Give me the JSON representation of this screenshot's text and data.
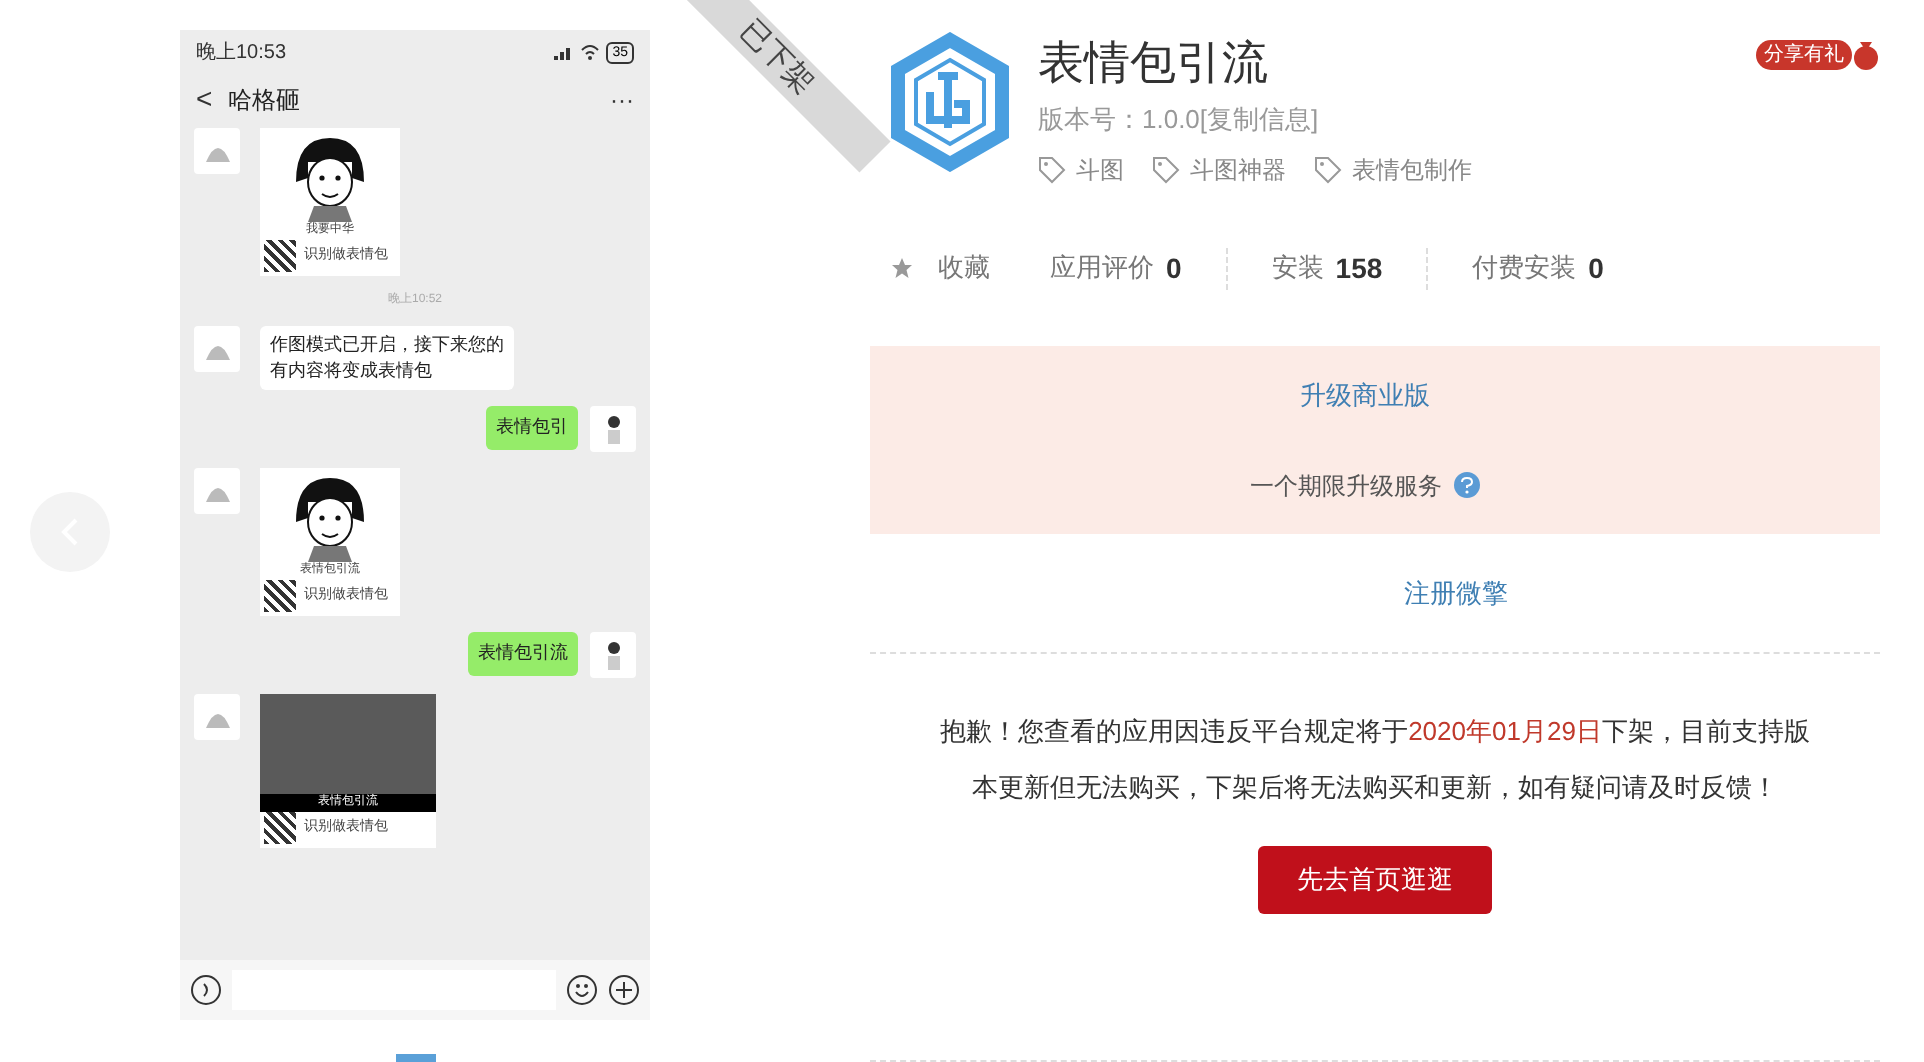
{
  "phone": {
    "status_time": "晚上10:53",
    "battery": "35",
    "back": "<",
    "chat_title": "哈格砸",
    "more": "···",
    "messages": [
      {
        "kind": "sticker",
        "caption": "我要中华",
        "qr_label": "识别做表情包"
      },
      {
        "kind": "time",
        "text": "晚上10:52"
      },
      {
        "kind": "text",
        "lines": [
          "作图模式已开启，接下来您的",
          "有内容将变成表情包"
        ]
      },
      {
        "kind": "outgoing",
        "text": "表情包引"
      },
      {
        "kind": "sticker",
        "caption": "表情包引流",
        "qr_label": "识别做表情包"
      },
      {
        "kind": "outgoing",
        "text": "表情包引流"
      },
      {
        "kind": "photo",
        "caption": "表情包引流",
        "qr_label": "识别做表情包"
      }
    ]
  },
  "ribbon": "已下架",
  "app": {
    "title": "表情包引流",
    "version": "版本号：1.0.0",
    "copy_link": "[复制信息]",
    "share_badge": "分享有礼",
    "tags": [
      "斗图",
      "斗图神器",
      "表情包制作"
    ]
  },
  "stats": [
    {
      "label": "收藏",
      "kind": "favorite"
    },
    {
      "label": "应用评价",
      "value": "0",
      "kind": "count"
    },
    {
      "label": "安装",
      "value": "158",
      "kind": "count"
    },
    {
      "label": "付费安装",
      "value": "0",
      "kind": "count"
    }
  ],
  "notice": {
    "upgrade_link": "升级商业版",
    "service_text": "一个期限升级服务",
    "register_link": "注册微擎"
  },
  "removal": {
    "before": "抱歉！您查看的应用因违反平台规定将于",
    "date": "2020年01月29日",
    "after": "下架，目前支持版本更新但无法购买，下架后将无法购买和更新，如有疑问请及时反馈！",
    "button": "先去首页逛逛"
  }
}
